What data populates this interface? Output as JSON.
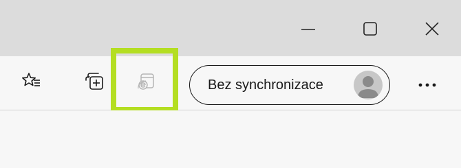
{
  "window_controls": {
    "minimize_icon": "minimize-icon",
    "maximize_icon": "maximize-icon",
    "close_icon": "close-icon"
  },
  "toolbar": {
    "favorites_icon": "favorites-list-icon",
    "collections_icon": "collections-add-icon",
    "ie_mode_icon": "internet-explorer-mode-icon",
    "profile": {
      "label": "Bez synchronizace",
      "avatar_icon": "person-avatar-icon"
    },
    "more_icon": "more-dots-icon"
  },
  "colors": {
    "highlight": "#b4de22",
    "titlebar": "#dcdcdc",
    "toolbar": "#f7f7f7"
  }
}
